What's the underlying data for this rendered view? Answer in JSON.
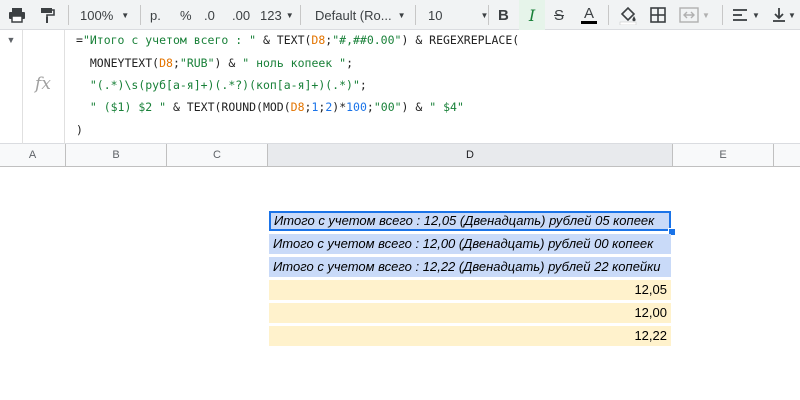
{
  "toolbar": {
    "zoom": "100%",
    "currency": "р.",
    "percent": "%",
    "dec_less": ".0",
    "dec_more": ".00",
    "more_formats": "123",
    "font": "Default (Ro...",
    "font_size": "10",
    "bold": "B",
    "italic": "I",
    "strike": "S",
    "text_color": "A"
  },
  "formula": {
    "line1": [
      "=",
      "\"Итого с учетом всего : \"",
      " & TEXT(",
      "D8",
      ";",
      "\"#,##0.00\"",
      ") & REGEXREPLACE("
    ],
    "line2": [
      "  MONEYTEXT(",
      "D8",
      ";",
      "\"RUB\"",
      ") & ",
      "\" ноль копеек \"",
      ";"
    ],
    "line3": [
      "  ",
      "\"(.*)\\s(руб[а-я]+)(.*?)(коп[а-я]+)(.*)\"",
      ";"
    ],
    "line4": [
      "  ",
      "\" ($1) $2 \"",
      " & TEXT(ROUND(MOD(",
      "D8",
      ";",
      "1",
      ";",
      "2",
      ")*",
      "100",
      ";",
      "\"00\"",
      ") & ",
      "\" $4\""
    ],
    "line5": ")"
  },
  "columns": [
    "A",
    "B",
    "C",
    "D",
    "E"
  ],
  "cells": {
    "row1": "Итого с учетом всего : 12,05 (Двенадцать) рублей 05 копеек",
    "row2": "Итого с учетом всего : 12,00 (Двенадцать) рублей 00 копеек",
    "row3": "Итого с учетом всего : 12,22 (Двенадцать) рублей 22 копейки",
    "row4": "12,05",
    "row5": "12,00",
    "row6": "12,22"
  },
  "colors": {
    "selected_fill": "#c9daf8",
    "input_fill": "#fff2cc",
    "accent": "#1a73e8",
    "string_green": "#188038",
    "ref_orange": "#e37400"
  }
}
